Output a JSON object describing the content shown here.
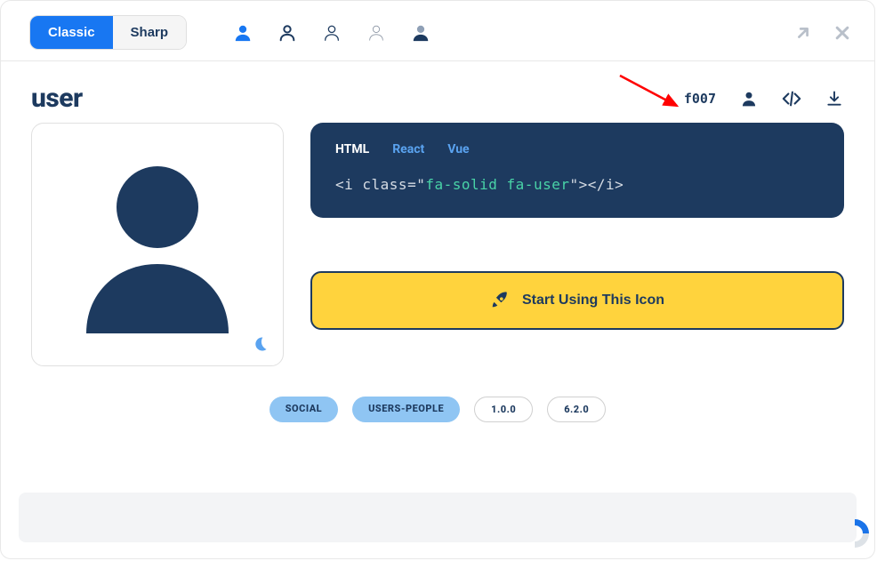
{
  "toggle": {
    "classic": "Classic",
    "sharp": "Sharp"
  },
  "title": "user",
  "unicode": "f007",
  "code": {
    "tabs": {
      "html": "HTML",
      "react": "React",
      "vue": "Vue"
    },
    "prefix": "<i class=",
    "quote": "\"",
    "classname": "fa-solid fa-user",
    "suffix": "></i>"
  },
  "cta": "Start Using This Icon",
  "tags": {
    "social": "SOCIAL",
    "users_people": "USERS-PEOPLE",
    "v1": "1.0.0",
    "v6": "6.2.0"
  }
}
